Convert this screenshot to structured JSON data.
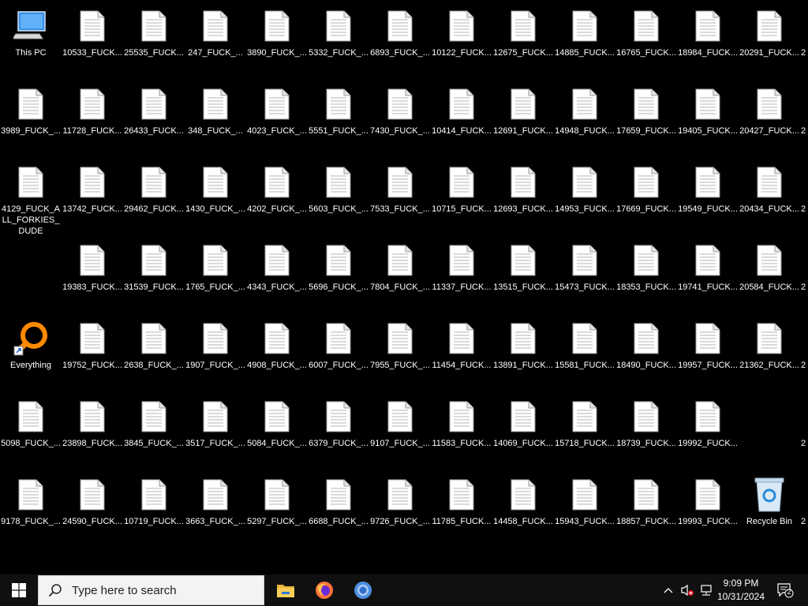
{
  "desktop": {
    "rows": [
      [
        "This PC",
        "10533_FUCK...",
        "25535_FUCK...",
        "247_FUCK_...",
        "3890_FUCK_...",
        "5332_FUCK_...",
        "6893_FUCK_...",
        "10122_FUCK...",
        "12675_FUCK...",
        "14885_FUCK...",
        "16765_FUCK...",
        "18984_FUCK...",
        "20291_FUCK...",
        "2"
      ],
      [
        "3989_FUCK_...",
        "11728_FUCK...",
        "26433_FUCK...",
        "348_FUCK_...",
        "4023_FUCK_...",
        "5551_FUCK_...",
        "7430_FUCK_...",
        "10414_FUCK...",
        "12691_FUCK...",
        "14948_FUCK...",
        "17659_FUCK...",
        "19405_FUCK...",
        "20427_FUCK...",
        "2"
      ],
      [
        "4129_FUCK_ALL_FORKIES_DUDE",
        "13742_FUCK...",
        "29462_FUCK...",
        "1430_FUCK_...",
        "4202_FUCK_...",
        "5603_FUCK_...",
        "7533_FUCK_...",
        "10715_FUCK...",
        "12693_FUCK...",
        "14953_FUCK...",
        "17669_FUCK...",
        "19549_FUCK...",
        "20434_FUCK...",
        "2"
      ],
      [
        "",
        "19383_FUCK...",
        "31539_FUCK...",
        "1765_FUCK_...",
        "4343_FUCK_...",
        "5696_FUCK_...",
        "7804_FUCK_...",
        "11337_FUCK...",
        "13515_FUCK...",
        "15473_FUCK...",
        "18353_FUCK...",
        "19741_FUCK...",
        "20584_FUCK...",
        "2"
      ],
      [
        "Everything",
        "19752_FUCK...",
        "2638_FUCK_...",
        "1907_FUCK_...",
        "4908_FUCK_...",
        "6007_FUCK_...",
        "7955_FUCK_...",
        "11454_FUCK...",
        "13891_FUCK...",
        "15581_FUCK...",
        "18490_FUCK...",
        "19957_FUCK...",
        "21362_FUCK...",
        "2"
      ],
      [
        "5098_FUCK_...",
        "23898_FUCK...",
        "3845_FUCK_...",
        "3517_FUCK_...",
        "5084_FUCK_...",
        "6379_FUCK_...",
        "9107_FUCK_...",
        "11583_FUCK...",
        "14069_FUCK...",
        "15718_FUCK...",
        "18739_FUCK...",
        "19992_FUCK...",
        "",
        "2"
      ],
      [
        "9178_FUCK_...",
        "24590_FUCK...",
        "10719_FUCK...",
        "3663_FUCK_...",
        "5297_FUCK_...",
        "6688_FUCK_...",
        "9726_FUCK_...",
        "11785_FUCK...",
        "14458_FUCK...",
        "15943_FUCK...",
        "18857_FUCK...",
        "19993_FUCK...",
        "Recycle Bin",
        "2"
      ]
    ],
    "special": {
      "This PC": "this-pc",
      "Everything": "everything",
      "Recycle Bin": "recycle-bin"
    }
  },
  "taskbar": {
    "search_placeholder": "Type here to search",
    "apps": [
      {
        "name": "file-explorer-icon"
      },
      {
        "name": "firefox-icon"
      },
      {
        "name": "chromium-icon"
      }
    ],
    "clock_time": "9:09 PM",
    "clock_date": "10/31/2024",
    "notification_count": "2"
  }
}
